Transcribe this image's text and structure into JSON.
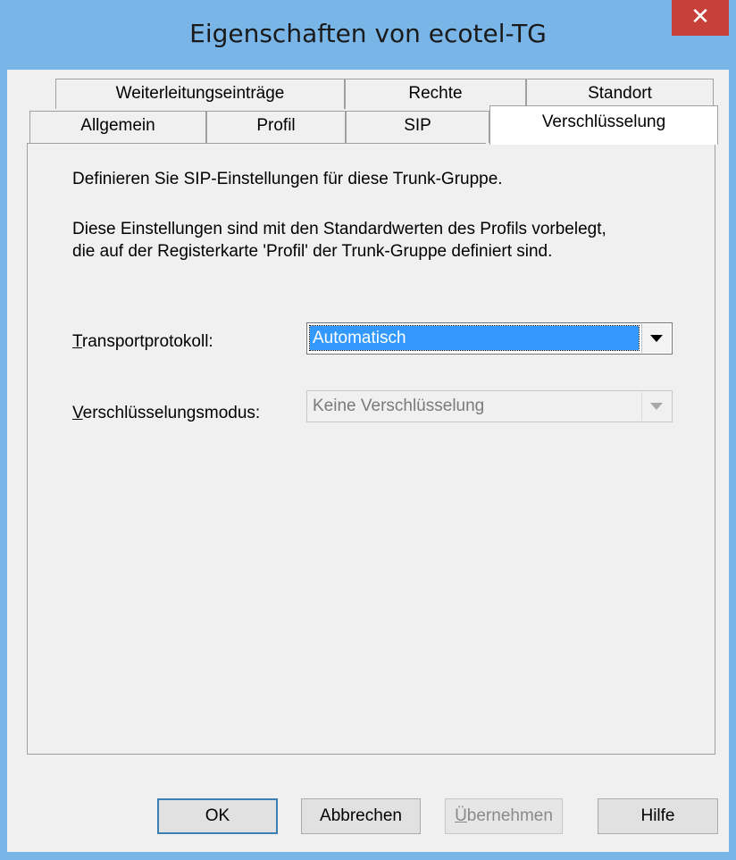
{
  "window": {
    "title": "Eigenschaften von ecotel-TG",
    "close_glyph": "✕"
  },
  "tabs_row1": [
    {
      "label": "Weiterleitungseinträge"
    },
    {
      "label": "Rechte"
    },
    {
      "label": "Standort"
    }
  ],
  "tabs_row2": [
    {
      "label": "Allgemein"
    },
    {
      "label": "Profil"
    },
    {
      "label": "SIP"
    },
    {
      "label": "Verschlüsselung",
      "active": true
    }
  ],
  "panel": {
    "intro": "Definieren Sie SIP-Einstellungen für diese Trunk-Gruppe.",
    "info_line1": "Diese Einstellungen sind mit den Standardwerten des Profils vorbelegt,",
    "info_line2": "die auf der Registerkarte  'Profil' der Trunk-Gruppe definiert sind.",
    "transport": {
      "mnemonic": "T",
      "label_rest": "ransportprotokoll:",
      "value": "Automatisch"
    },
    "encryption": {
      "mnemonic": "V",
      "label_rest": "erschlüsselungsmodus:",
      "value": "Keine Verschlüsselung"
    }
  },
  "buttons": {
    "ok": "OK",
    "cancel": "Abbrechen",
    "apply_mnemonic": "Ü",
    "apply_rest": "bernehmen",
    "help": "Hilfe"
  },
  "colors": {
    "frame": "#7ab5e8",
    "close": "#c7403a",
    "selection": "#3399ff",
    "dialog_bg": "#f0f0f0"
  }
}
